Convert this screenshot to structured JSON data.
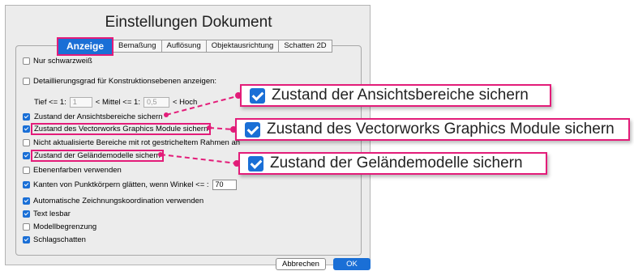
{
  "dialog": {
    "title": "Einstellungen Dokument",
    "tabs": [
      "Anzeige",
      "Bemaßung",
      "Auflösung",
      "Objektausrichtung",
      "Schatten 2D"
    ],
    "active_tab": "Anzeige",
    "options": {
      "nur_schwarzweiss": {
        "label": "Nur schwarzweiß",
        "checked": false
      },
      "detaillierungsgrad": {
        "label": "Detaillierungsgrad für Konstruktionsebenen anzeigen:",
        "checked": false
      },
      "tief_label": "Tief <= 1:",
      "tief_value": "1",
      "mittel_label": "< Mittel <= 1:",
      "mittel_value": "0,5",
      "hoch_label": "< Hoch",
      "ansichtsbereiche": {
        "label": "Zustand der Ansichtsbereiche sichern",
        "checked": true
      },
      "graphics_module": {
        "label": "Zustand des Vectorworks Graphics Module sichern",
        "checked": true
      },
      "nicht_aktualisiert": {
        "label": "Nicht aktualisierte Bereiche mit rot gestricheltem Rahmen an",
        "checked": false
      },
      "gelaendemodelle": {
        "label": "Zustand der Geländemodelle sichern",
        "checked": true
      },
      "ebenenfarben": {
        "label": "Ebenenfarben verwenden",
        "checked": false
      },
      "kanten": {
        "label": "Kanten von Punktkörpern glätten, wenn Winkel <= :",
        "checked": true,
        "value": "70"
      },
      "zeichnungskoordination": {
        "label": "Automatische Zeichnungskoordination verwenden",
        "checked": true
      },
      "text_lesbar": {
        "label": "Text lesbar",
        "checked": true
      },
      "modellbegrenzung": {
        "label": "Modellbegrenzung",
        "checked": false
      },
      "schlagschatten": {
        "label": "Schlagschatten",
        "checked": true
      }
    },
    "buttons": {
      "cancel": "Abbrechen",
      "ok": "OK"
    }
  },
  "callouts": [
    "Zustand der Ansichtsbereiche sichern",
    "Zustand des Vectorworks Graphics Module sichern",
    "Zustand der Geländemodelle sichern"
  ],
  "colors": {
    "accent": "#1a6fd6",
    "highlight": "#e31c79"
  }
}
